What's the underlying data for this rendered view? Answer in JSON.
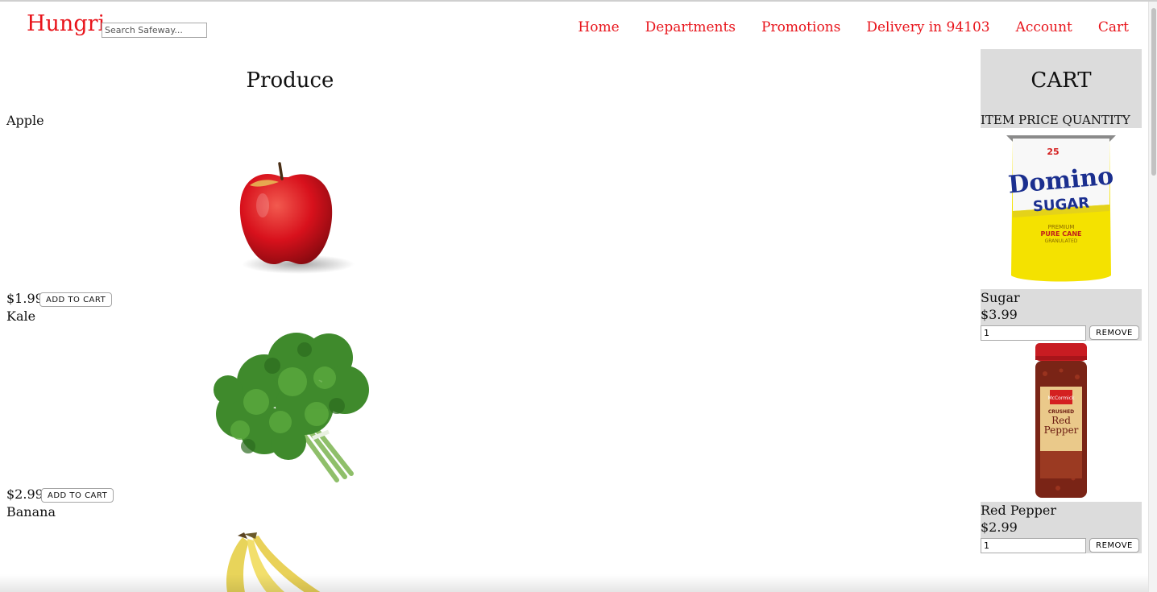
{
  "header": {
    "logo": "Hungri",
    "search_placeholder": "Search Safeway...",
    "nav": [
      "Home",
      "Departments",
      "Promotions",
      "Delivery in 94103",
      "Account",
      "Cart"
    ]
  },
  "produce": {
    "title": "Produce",
    "add_label": "ADD TO CART",
    "items": [
      {
        "name": "Apple",
        "price": "$1.99"
      },
      {
        "name": "Kale",
        "price": "$2.99"
      },
      {
        "name": "Banana"
      }
    ]
  },
  "cart": {
    "title": "CART",
    "columns": "ITEM PRICE QUANTITY",
    "remove_label": "REMOVE",
    "items": [
      {
        "name": "Sugar",
        "price": "$3.99",
        "qty": "1"
      },
      {
        "name": "Red Pepper",
        "price": "$2.99",
        "qty": "1"
      }
    ],
    "sugar_pkg": {
      "count": "25",
      "brand": "Domino",
      "product": "SUGAR",
      "line1": "PREMIUM",
      "line2": "PURE CANE",
      "line3": "GRANULATED"
    },
    "pepper_pkg": {
      "brand": "McCormick",
      "line1": "CRUSHED",
      "line2": "Red",
      "line3": "Pepper"
    }
  },
  "colors": {
    "brand": "#e8141b",
    "cart_bg": "#dcdcdc"
  }
}
